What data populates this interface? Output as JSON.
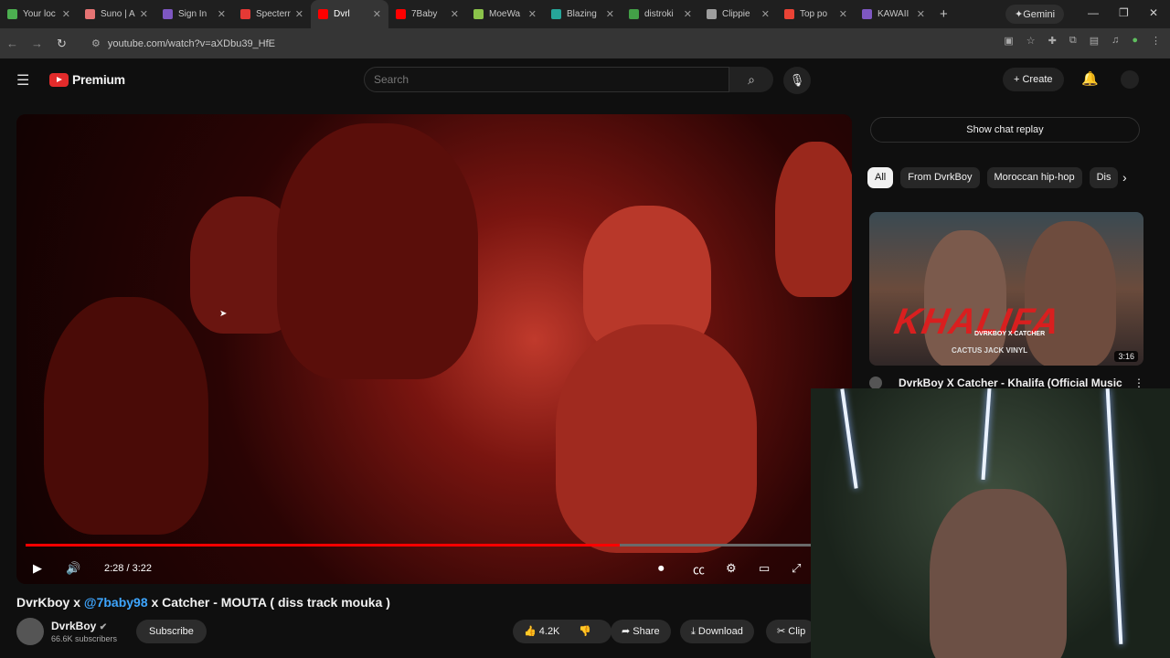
{
  "browser": {
    "tabs": [
      {
        "label": "Your loc",
        "color": "#4caf50"
      },
      {
        "label": "Suno | A",
        "color": "#e57373"
      },
      {
        "label": "Sign In",
        "color": "#7e57c2"
      },
      {
        "label": "Specterr",
        "color": "#e53935"
      },
      {
        "label": "Dvrl",
        "color": "#ff0000",
        "active": true
      },
      {
        "label": "7Baby",
        "color": "#ff0000"
      },
      {
        "label": "MoeWa",
        "color": "#8bc34a"
      },
      {
        "label": "Blazing",
        "color": "#26a69a"
      },
      {
        "label": "distroki",
        "color": "#43a047"
      },
      {
        "label": "Clippie",
        "color": "#9e9e9e"
      },
      {
        "label": "Top po",
        "color": "#ea4335"
      },
      {
        "label": "KAWAII",
        "color": "#7e57c2"
      }
    ],
    "new_tab": "+",
    "gemini_label": "Gemini",
    "url": "youtube.com/watch?v=aXDbu39_HfE"
  },
  "youtube": {
    "logo_text": "Premium",
    "search_placeholder": "Search",
    "create_label": "Create"
  },
  "player": {
    "time": "2:28 / 3:22",
    "progress_fraction": 0.735
  },
  "video_info": {
    "title_prefix": "DvrKboy x ",
    "title_mention": "@7baby98",
    "title_suffix": " x Catcher - MOUTA ( diss track mouka )",
    "channel_name": "DvrkBoy",
    "subscribers": "66.6K subscribers",
    "subscribe_label": "Subscribe",
    "likes": "4.2K",
    "share_label": "Share",
    "download_label": "Download",
    "clip_label": "Clip"
  },
  "sidebar": {
    "chat_replay": "Show chat replay",
    "chips": [
      "All",
      "From DvrkBoy",
      "Moroccan hip-hop",
      "Dis"
    ],
    "rec_title": "DvrkBoy X Catcher - Khalifa (Official Music",
    "rec_duration": "3:16",
    "thumb_text": "KHALIFA",
    "thumb_sub": "DVRKBOY X CATCHER",
    "thumb_sub2": "CACTUS JACK  VINYL"
  }
}
